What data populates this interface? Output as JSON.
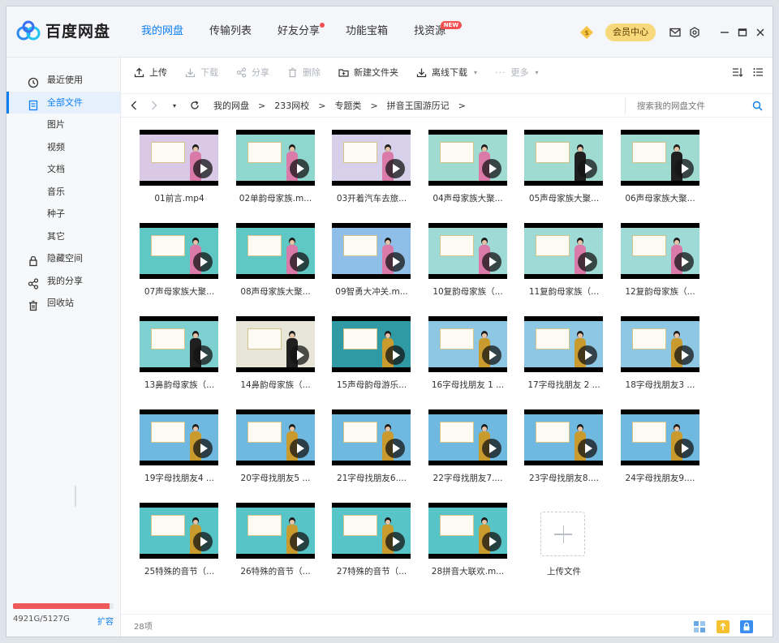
{
  "app": {
    "logo_text": "百度网盘"
  },
  "nav": {
    "tabs": [
      {
        "label": "我的网盘",
        "active": true
      },
      {
        "label": "传输列表"
      },
      {
        "label": "好友分享",
        "dot": true
      },
      {
        "label": "功能宝箱"
      },
      {
        "label": "找资源",
        "badge": "NEW"
      }
    ]
  },
  "header": {
    "vip_label": "会员中心"
  },
  "sidebar": {
    "items": [
      {
        "label": "最近使用",
        "icon": "clock-icon"
      },
      {
        "label": "全部文件",
        "icon": "document-icon",
        "active": true
      },
      {
        "label": "图片"
      },
      {
        "label": "视频"
      },
      {
        "label": "文档"
      },
      {
        "label": "音乐"
      },
      {
        "label": "种子"
      },
      {
        "label": "其它"
      },
      {
        "label": "隐藏空间",
        "icon": "lock-icon"
      },
      {
        "label": "我的分享",
        "icon": "share-icon"
      },
      {
        "label": "回收站",
        "icon": "trash-icon"
      }
    ],
    "quota": {
      "used_fraction": 0.96,
      "text": "4921G/5127G",
      "expand": "扩容"
    }
  },
  "toolbar": {
    "upload": "上传",
    "download": "下载",
    "share": "分享",
    "delete": "删除",
    "new_folder": "新建文件夹",
    "offline_download": "离线下载",
    "more": "更多"
  },
  "path": {
    "crumbs": [
      "我的网盘",
      "233网校",
      "专题类",
      "拼音王国游历记"
    ],
    "search_placeholder": "搜索我的网盘文件"
  },
  "files": [
    {
      "name": "01前言.mp4",
      "color": "#d9c9e6"
    },
    {
      "name": "02单韵母家族.m...",
      "color": "#8fd6ce"
    },
    {
      "name": "03开着汽车去旅...",
      "color": "#d6d0ea"
    },
    {
      "name": "04声母家族大聚...",
      "color": "#9fdbd1"
    },
    {
      "name": "05声母家族大聚...",
      "color": "#9fdbd1"
    },
    {
      "name": "06声母家族大聚...",
      "color": "#9fdbd1"
    },
    {
      "name": "07声母家族大聚...",
      "color": "#5fc8c4"
    },
    {
      "name": "08声母家族大聚...",
      "color": "#5fc8c4"
    },
    {
      "name": "09智勇大冲关.m...",
      "color": "#8fbfe8"
    },
    {
      "name": "10复韵母家族（...",
      "color": "#9edbd6"
    },
    {
      "name": "11复韵母家族（...",
      "color": "#9edbd6"
    },
    {
      "name": "12复韵母家族（...",
      "color": "#9edbd6"
    },
    {
      "name": "13鼻韵母家族（...",
      "color": "#7fd0d0"
    },
    {
      "name": "14鼻韵母家族（...",
      "color": "#e7e5d8"
    },
    {
      "name": "15声母韵母游乐...",
      "color": "#2f9aa3"
    },
    {
      "name": "16字母找朋友 1 ...",
      "color": "#8ec7e3"
    },
    {
      "name": "17字母找朋友 2 ...",
      "color": "#8ec7e3"
    },
    {
      "name": "18字母找朋友3 ...",
      "color": "#8ec7e3"
    },
    {
      "name": "19字母找朋友4 ...",
      "color": "#6fb9e0"
    },
    {
      "name": "20字母找朋友5 ...",
      "color": "#6fb9e0"
    },
    {
      "name": "21字母找朋友6....",
      "color": "#6fb9e0"
    },
    {
      "name": "22字母找朋友7....",
      "color": "#6fb9e0"
    },
    {
      "name": "23字母找朋友8....",
      "color": "#6fb9e0"
    },
    {
      "name": "24字母找朋友9....",
      "color": "#6fb9e0"
    },
    {
      "name": "25特殊的音节（...",
      "color": "#57c4c8"
    },
    {
      "name": "26特殊的音节（...",
      "color": "#57c4c8"
    },
    {
      "name": "27特殊的音节（...",
      "color": "#57c4c8"
    },
    {
      "name": "28拼音大联欢.m...",
      "color": "#57c4c8"
    }
  ],
  "upload_tile": {
    "label": "上传文件"
  },
  "footer": {
    "count": "28项"
  },
  "colors": {
    "accent": "#0c7ef2",
    "quota_fill": "#ee5a5a",
    "vip": "#f7d87a"
  }
}
